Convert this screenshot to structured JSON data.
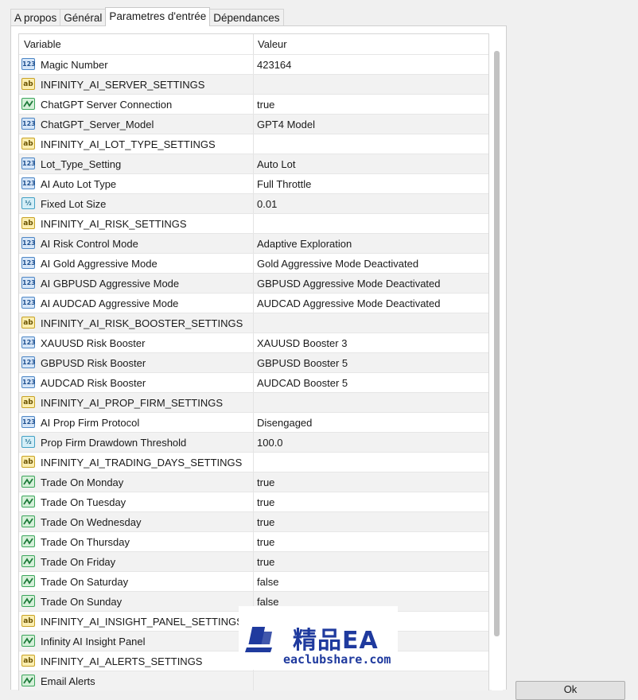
{
  "tabs": [
    {
      "label": "A propos"
    },
    {
      "label": "Général"
    },
    {
      "label": "Parametres d'entrée"
    },
    {
      "label": "Dépendances"
    }
  ],
  "table": {
    "col_variable": "Variable",
    "col_value": "Valeur",
    "rows": [
      {
        "type": "num",
        "name": "Magic Number",
        "value": "423164"
      },
      {
        "type": "str",
        "name": "INFINITY_AI_SERVER_SETTINGS",
        "value": ""
      },
      {
        "type": "bool",
        "name": "ChatGPT Server Connection",
        "value": "true"
      },
      {
        "type": "num",
        "name": "ChatGPT_Server_Model",
        "value": "GPT4 Model"
      },
      {
        "type": "str",
        "name": "INFINITY_AI_LOT_TYPE_SETTINGS",
        "value": ""
      },
      {
        "type": "num",
        "name": "Lot_Type_Setting",
        "value": "Auto Lot"
      },
      {
        "type": "num",
        "name": "AI Auto Lot Type",
        "value": "Full Throttle"
      },
      {
        "type": "dbl",
        "name": "Fixed Lot Size",
        "value": "0.01"
      },
      {
        "type": "str",
        "name": "INFINITY_AI_RISK_SETTINGS",
        "value": ""
      },
      {
        "type": "num",
        "name": "AI Risk Control Mode",
        "value": "Adaptive Exploration"
      },
      {
        "type": "num",
        "name": "AI Gold Aggressive Mode",
        "value": "Gold Aggressive Mode Deactivated"
      },
      {
        "type": "num",
        "name": "AI GBPUSD Aggressive Mode",
        "value": "GBPUSD Aggressive Mode Deactivated"
      },
      {
        "type": "num",
        "name": "AI AUDCAD Aggressive Mode",
        "value": "AUDCAD Aggressive Mode Deactivated"
      },
      {
        "type": "str",
        "name": "INFINITY_AI_RISK_BOOSTER_SETTINGS",
        "value": ""
      },
      {
        "type": "num",
        "name": "XAUUSD Risk Booster",
        "value": "XAUUSD Booster 3"
      },
      {
        "type": "num",
        "name": "GBPUSD Risk Booster",
        "value": "GBPUSD Booster 5"
      },
      {
        "type": "num",
        "name": "AUDCAD Risk Booster",
        "value": "AUDCAD Booster 5"
      },
      {
        "type": "str",
        "name": "INFINITY_AI_PROP_FIRM_SETTINGS",
        "value": ""
      },
      {
        "type": "num",
        "name": "AI Prop Firm Protocol",
        "value": "Disengaged"
      },
      {
        "type": "dbl",
        "name": "Prop Firm Drawdown Threshold",
        "value": "100.0"
      },
      {
        "type": "str",
        "name": "INFINITY_AI_TRADING_DAYS_SETTINGS",
        "value": ""
      },
      {
        "type": "bool",
        "name": "Trade On Monday",
        "value": "true"
      },
      {
        "type": "bool",
        "name": "Trade On Tuesday",
        "value": "true"
      },
      {
        "type": "bool",
        "name": "Trade On Wednesday",
        "value": "true"
      },
      {
        "type": "bool",
        "name": "Trade On Thursday",
        "value": "true"
      },
      {
        "type": "bool",
        "name": "Trade On Friday",
        "value": "true"
      },
      {
        "type": "bool",
        "name": "Trade On Saturday",
        "value": "false"
      },
      {
        "type": "bool",
        "name": "Trade On Sunday",
        "value": "false"
      },
      {
        "type": "str",
        "name": "INFINITY_AI_INSIGHT_PANEL_SETTINGS",
        "value": ""
      },
      {
        "type": "bool",
        "name": "Infinity AI Insight Panel",
        "value": ""
      },
      {
        "type": "str",
        "name": "INFINITY_AI_ALERTS_SETTINGS",
        "value": ""
      },
      {
        "type": "bool",
        "name": "Email Alerts",
        "value": ""
      }
    ]
  },
  "icon_labels": {
    "num": "123",
    "str": "ab",
    "bool": "",
    "dbl": "½"
  },
  "watermark": {
    "title": "精品EA",
    "subtitle": "eaclubshare.com",
    "color": "#1f3a9e"
  },
  "right_button": {
    "label": "Ok"
  }
}
